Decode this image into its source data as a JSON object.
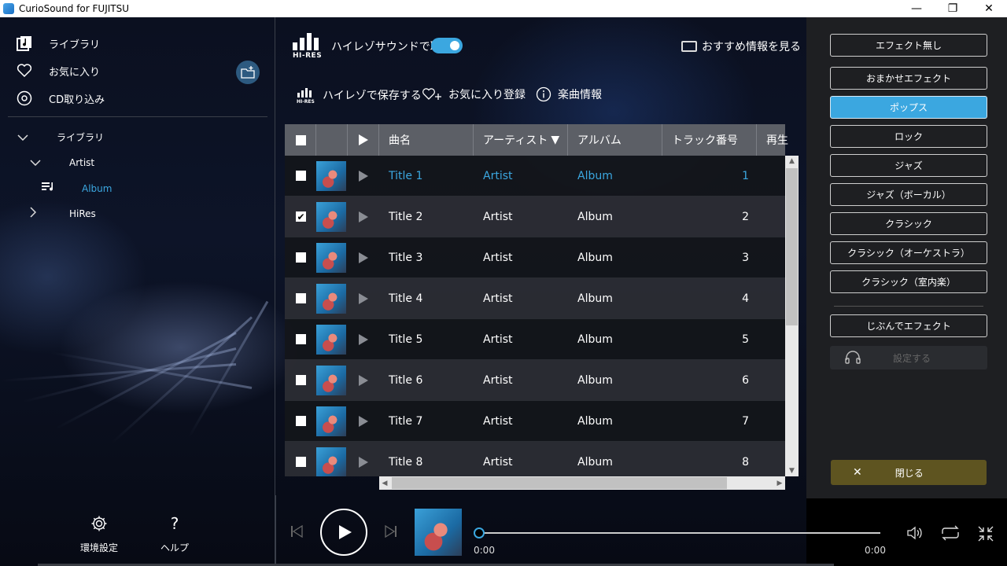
{
  "window": {
    "title": "CurioSound for FUJITSU",
    "minimize": "—",
    "maximize": "❐",
    "close": "✕"
  },
  "sidebar": {
    "nav": [
      {
        "label": "ライブラリ",
        "icon": "music-library-icon"
      },
      {
        "label": "お気に入り",
        "icon": "heart-icon"
      },
      {
        "label": "CD取り込み",
        "icon": "cd-icon"
      }
    ],
    "tree": {
      "root": "ライブラリ",
      "artist": "Artist",
      "album": "Album",
      "hires": "HiRes"
    },
    "settings_label": "環境設定",
    "help_label": "ヘルプ",
    "help_glyph": "?"
  },
  "topbar": {
    "hires_logo_text": "HI-RES",
    "hires_listen_label": "ハイレゾサウンドで聴く",
    "hires_listen_on": true,
    "recommend_label": "おすすめ情報を見る",
    "save_hires_label": "ハイレゾで保存する",
    "add_favorite_label": "お気に入り登録",
    "track_info_label": "楽曲情報"
  },
  "table": {
    "headers": {
      "title": "曲名",
      "artist": "アーティスト",
      "sort_arrow": "▼",
      "album": "アルバム",
      "track_no": "トラック番号",
      "play_count": "再生"
    },
    "rows": [
      {
        "title": "Title 1",
        "artist": "Artist",
        "album": "Album",
        "track": "1",
        "checked": false,
        "active": true
      },
      {
        "title": "Title 2",
        "artist": "Artist",
        "album": "Album",
        "track": "2",
        "checked": true,
        "active": false
      },
      {
        "title": "Title 3",
        "artist": "Artist",
        "album": "Album",
        "track": "3",
        "checked": false,
        "active": false
      },
      {
        "title": "Title 4",
        "artist": "Artist",
        "album": "Album",
        "track": "4",
        "checked": false,
        "active": false
      },
      {
        "title": "Title 5",
        "artist": "Artist",
        "album": "Album",
        "track": "5",
        "checked": false,
        "active": false
      },
      {
        "title": "Title 6",
        "artist": "Artist",
        "album": "Album",
        "track": "6",
        "checked": false,
        "active": false
      },
      {
        "title": "Title 7",
        "artist": "Artist",
        "album": "Album",
        "track": "7",
        "checked": false,
        "active": false
      },
      {
        "title": "Title 8",
        "artist": "Artist",
        "album": "Album",
        "track": "8",
        "checked": false,
        "active": false
      }
    ]
  },
  "player": {
    "elapsed": "0:00",
    "duration": "0:00",
    "progress": 0
  },
  "effects": {
    "buttons": [
      {
        "label": "エフェクト無し",
        "active": false
      },
      {
        "label": "おまかせエフェクト",
        "active": false
      },
      {
        "label": "ポップス",
        "active": true
      },
      {
        "label": "ロック",
        "active": false
      },
      {
        "label": "ジャズ",
        "active": false
      },
      {
        "label": "ジャズ（ボーカル）",
        "active": false
      },
      {
        "label": "クラシック",
        "active": false
      },
      {
        "label": "クラシック（オーケストラ）",
        "active": false
      },
      {
        "label": "クラシック（室内楽）",
        "active": false
      }
    ],
    "custom_label": "じぶんでエフェクト",
    "settings_label": "設定する",
    "close_label": "閉じる"
  },
  "colors": {
    "accent": "#3ba7e0",
    "close_button": "#5e5420",
    "panel_bg": "#1e1f22"
  }
}
